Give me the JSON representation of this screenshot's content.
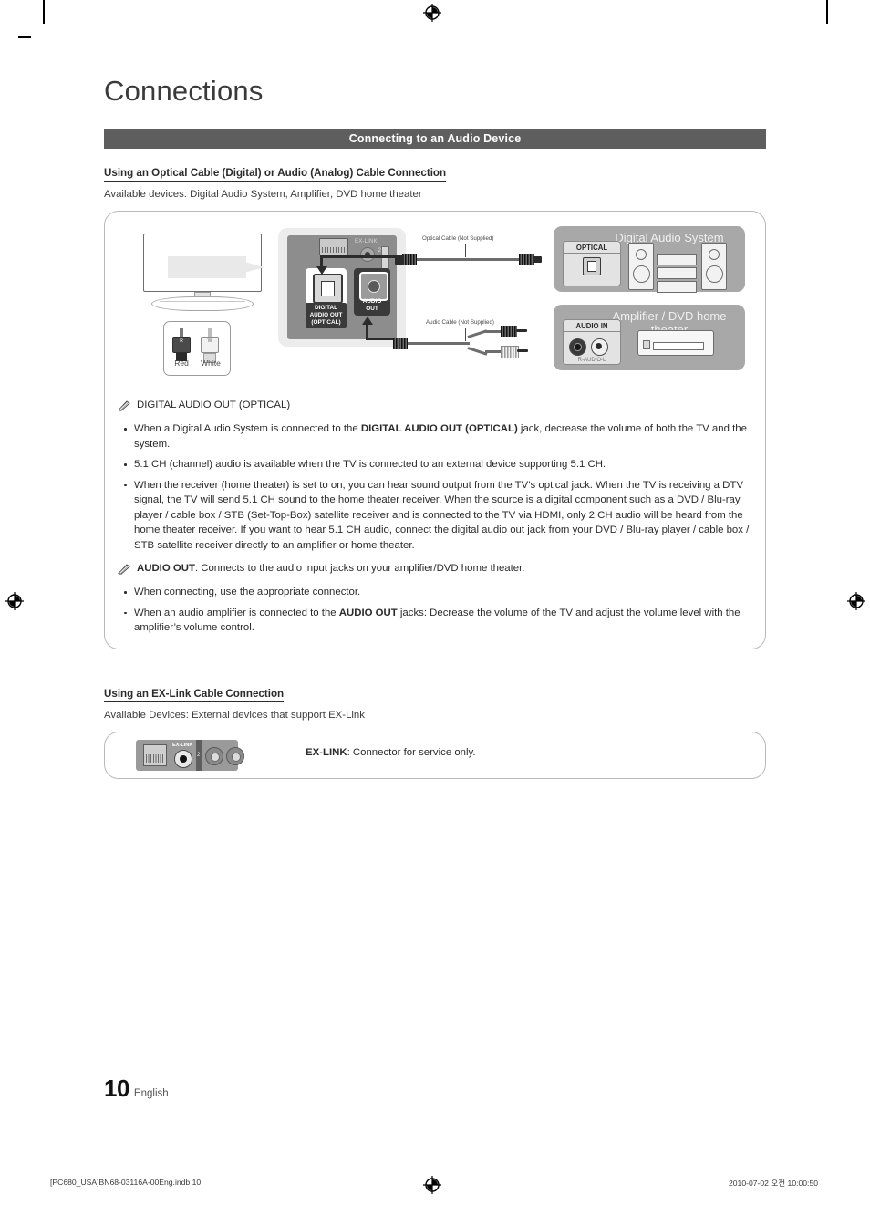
{
  "chapter": {
    "title": "Connections"
  },
  "section_bar": {
    "label": "Connecting to an Audio Device"
  },
  "optical_section": {
    "heading": "Using an Optical Cable (Digital) or Audio (Analog) Cable Connection",
    "available": "Available devices: Digital Audio System, Amplifier, DVD home theater"
  },
  "diagram": {
    "tv_panel": {
      "exlink_label": "EX-LINK",
      "slot_2": "2",
      "slot_1": "1",
      "digital_jack_caption": "DIGITAL\nAUDIO OUT\n(OPTICAL)",
      "digital_jack_line1": "DIGITAL",
      "digital_jack_line2": "AUDIO OUT",
      "digital_jack_line3": "(OPTICAL)",
      "audio_jack_line1": "AUDIO",
      "audio_jack_line2": "OUT"
    },
    "plug_legend": {
      "red": "Red",
      "white": "White",
      "red_letter": "R",
      "white_letter": "W"
    },
    "cables": {
      "optical": "Optical Cable (Not Supplied)",
      "audio": "Audio Cable (Not Supplied)"
    },
    "devices": [
      {
        "title": "Digital Audio System",
        "port_label": "OPTICAL"
      },
      {
        "title": "Amplifier / DVD home theater",
        "port_label": "AUDIO IN",
        "port_sub": "R-AUDIO-L"
      }
    ]
  },
  "notes": {
    "digital": {
      "title": "DIGITAL AUDIO OUT (OPTICAL)",
      "bullets": [
        {
          "pre": "When a Digital Audio System is connected to the ",
          "bold": "DIGITAL AUDIO OUT (OPTICAL)",
          "post": " jack, decrease the volume of both the TV and the system."
        },
        {
          "pre": "5.1 CH (channel) audio is available when the TV is connected to an external device supporting 5.1 CH.",
          "bold": "",
          "post": ""
        },
        {
          "pre": "When the receiver (home theater) is set to on, you can hear sound output from the TV’s optical jack. When the TV is receiving a DTV signal, the TV will send 5.1 CH sound to the home theater receiver. When the source is a digital component such as a DVD / Blu-ray player / cable box / STB (Set-Top-Box) satellite receiver and is connected to the TV via HDMI, only 2 CH audio will be heard from the home theater receiver. If you want to hear 5.1 CH audio, connect the digital audio out jack from your DVD / Blu-ray player / cable box / STB satellite receiver directly to an amplifier or home theater.",
          "bold": "",
          "post": ""
        }
      ]
    },
    "audio": {
      "title_bold": "AUDIO OUT",
      "title_rest": ": Connects to the audio input jacks on your amplifier/DVD home theater.",
      "bullets": [
        {
          "pre": "When connecting, use the appropriate connector.",
          "bold": "",
          "post": ""
        },
        {
          "pre": "When an audio amplifier is connected to the ",
          "bold": "AUDIO OUT",
          "post": " jacks: Decrease the volume of the TV and adjust the volume level with the amplifier’s volume control."
        }
      ]
    }
  },
  "exlink_section": {
    "heading": "Using an EX-Link Cable Connection",
    "available": "Available Devices: External devices that support EX-Link",
    "panel_label": "EX-LINK",
    "panel_num": "2",
    "description_bold": "EX-LINK",
    "description_rest": ": Connector for service only."
  },
  "footer": {
    "page_number": "10",
    "language": "English",
    "file_left": "[PC680_USA]BN68-03116A-00Eng.indb   10",
    "stamp_right": "2010-07-02   오전 10:00:50"
  },
  "colors": {
    "section_bar": "#5e5e5e",
    "panel_dark": "#8d8d8d",
    "device_box": "#a8a8a8",
    "text": "#2b2b2b"
  }
}
